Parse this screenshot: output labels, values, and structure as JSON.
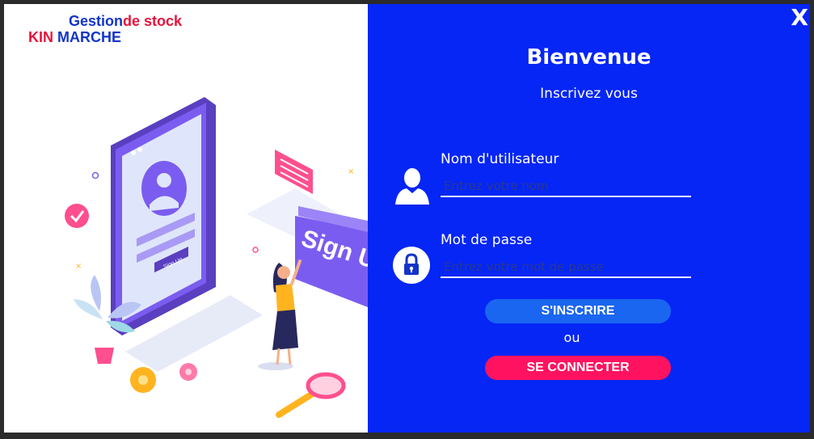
{
  "brand": {
    "line1_a": "Gestion",
    "line1_b": "de stock",
    "line2_a": "KIN",
    "line2_b": "MARCHE"
  },
  "illustration": {
    "phone_button": "Sign Up",
    "banner_text": "Sign U"
  },
  "form": {
    "title": "Bienvenue",
    "subtitle": "Inscrivez vous",
    "username_label": "Nom d'utilisateur",
    "username_placeholder": "Entrez votre nom",
    "password_label": "Mot de passe",
    "password_placeholder": "Entrez votre mot de passe",
    "signup_button": "S'INSCRIRE",
    "or_text": "ou",
    "login_button": "SE CONNECTER"
  },
  "window": {
    "close_label": "X"
  },
  "colors": {
    "panel": "#0526f5",
    "signup": "#1a66f0",
    "login": "#ff1360",
    "brand_blue": "#1234c8",
    "brand_red": "#e8133c"
  }
}
